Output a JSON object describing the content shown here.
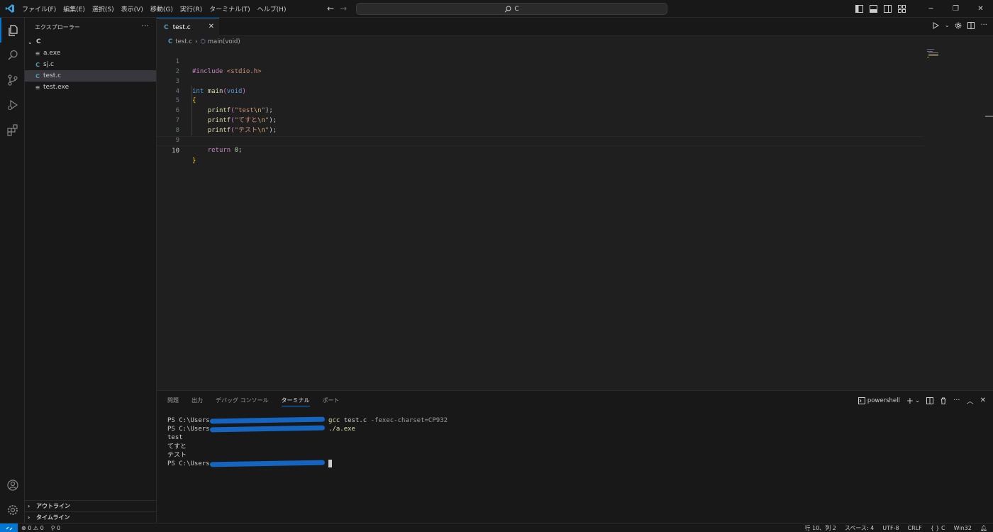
{
  "titlebar": {
    "menus": [
      "ファイル(F)",
      "編集(E)",
      "選択(S)",
      "表示(V)",
      "移動(G)",
      "実行(R)",
      "ターミナル(T)",
      "ヘルプ(H)"
    ],
    "search": "C",
    "back_icon": "arrow-left-icon",
    "forward_icon": "arrow-right-icon"
  },
  "activitybar": {
    "items": [
      "explorer-icon",
      "search-icon",
      "source-control-icon",
      "run-debug-icon",
      "extensions-icon"
    ],
    "bottom": [
      "account-icon",
      "gear-icon"
    ]
  },
  "sidebar": {
    "title": "エクスプローラー",
    "more": "···",
    "folder": "C",
    "files": [
      {
        "name": "a.exe",
        "type": "exe",
        "glyph": "≡"
      },
      {
        "name": "sj.c",
        "type": "c",
        "glyph": "C"
      },
      {
        "name": "test.c",
        "type": "c",
        "glyph": "C"
      },
      {
        "name": "test.exe",
        "type": "exe",
        "glyph": "≡"
      }
    ],
    "selected": "test.c",
    "outline": "アウトライン",
    "timeline": "タイムライン"
  },
  "editor": {
    "tab": {
      "label": "test.c",
      "glyph": "C",
      "close": "✕"
    },
    "breadcrumb": {
      "file": "test.c",
      "symbol": "main(void)"
    },
    "current_line": 10,
    "lines": [
      {
        "num": "1"
      },
      {
        "num": "2"
      },
      {
        "num": "3"
      },
      {
        "num": "4"
      },
      {
        "num": "5"
      },
      {
        "num": "6"
      },
      {
        "num": "7"
      },
      {
        "num": "8"
      },
      {
        "num": "9"
      },
      {
        "num": "10"
      }
    ],
    "code": {
      "l1_pre": "#include",
      "l1_inc": "<stdio.h>",
      "l3_type": "int",
      "l3_fn": "main",
      "l3_open": "(",
      "l3_param": "void",
      "l3_close": ")",
      "l4_brace": "{",
      "fn_printf": "printf",
      "l5_str1": "\"test",
      "l6_str1": "\"てすと",
      "l7_str1": "\"テスト",
      "esc": "\\n",
      "str_end": "\"",
      "stmt_end": ");",
      "open_paren": "(",
      "l9_kw": "return",
      "l9_num": "0",
      "semi": ";",
      "l10_brace": "}"
    }
  },
  "panel": {
    "tabs": [
      "問題",
      "出力",
      "デバッグ コンソール",
      "ターミナル",
      "ポート"
    ],
    "active_tab": "ターミナル",
    "shell": "powershell",
    "terminal": {
      "prompt": "PS C:\\Users",
      "cmd1": "gcc",
      "cmd1_file": "test.c",
      "cmd1_arg": "-fexec-charset=CP932",
      "cmd2": "./a.exe",
      "out1": "test",
      "out2": "てすと",
      "out3": "テスト"
    }
  },
  "statusbar": {
    "errors": "0",
    "warnings": "0",
    "ports": "0",
    "position": "行 10、列 2",
    "spaces": "スペース: 4",
    "encoding": "UTF-8",
    "eol": "CRLF",
    "language": "C",
    "platform": "Win32"
  },
  "colors": {
    "accent": "#0078d4",
    "background": "#1f1f1f",
    "sidebar": "#181818"
  }
}
